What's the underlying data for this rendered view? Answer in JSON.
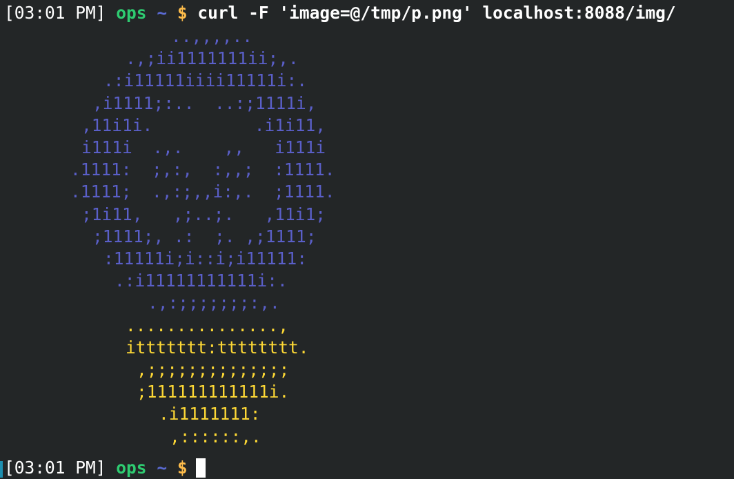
{
  "terminal": {
    "prompt1": {
      "timestamp": "[03:01 PM]",
      "user": "ops",
      "path": "~",
      "symbol": "$",
      "command": "curl -F 'image=@/tmp/p.png' localhost:8088/img/"
    },
    "prompt2": {
      "timestamp": "[03:01 PM]",
      "user": "ops",
      "path": "~",
      "symbol": "$"
    }
  },
  "ascii_art": [
    {
      "text": "..,,,,..",
      "color": "blue"
    },
    {
      "text": ".,;ii1111111ii;,.",
      "color": "blue"
    },
    {
      "text": ".:i11111iiii11111i:.",
      "color": "blue"
    },
    {
      "text": ",i1111;:..  ..:;1111i,",
      "color": "blue"
    },
    {
      "text": ",11i1i.          .i1i11,",
      "color": "blue"
    },
    {
      "text": "i111i  .,.    ,,   i111i",
      "color": "blue"
    },
    {
      "text": ".1111:  ;,:,  :,,;  :1111.",
      "color": "blue"
    },
    {
      "text": ".1111;  .,:;,,i:,.  ;1111.",
      "color": "blue"
    },
    {
      "text": ";1i11,   ,;..;.   ,11i1;",
      "color": "blue"
    },
    {
      "text": ";1111;, .:  ;. ,;1111;",
      "color": "blue"
    },
    {
      "text": ":11111i;i::i;i11111:",
      "color": "blue"
    },
    {
      "text": ".:i11111111111i:.",
      "color": "blue"
    },
    {
      "text": ".,:;;;;;;;:,.",
      "color": "blue"
    },
    {
      "text": "...............,",
      "color": "yellow"
    },
    {
      "text": "ittttttt:tttttttt.",
      "color": "yellow"
    },
    {
      "text": ",;;;;;;;;;;;;;;",
      "color": "yellow"
    },
    {
      "text": ";111111111111i.",
      "color": "yellow"
    },
    {
      "text": ".i1111111:",
      "color": "yellow"
    },
    {
      "text": ",::::::,.",
      "color": "yellow"
    }
  ],
  "colors": {
    "background": "#232627",
    "user": "#2ecc71",
    "tilde": "#5a6ad2",
    "dollar": "#fdbc4b",
    "art_blue": "#5a5fc8",
    "art_yellow": "#fdd835"
  }
}
